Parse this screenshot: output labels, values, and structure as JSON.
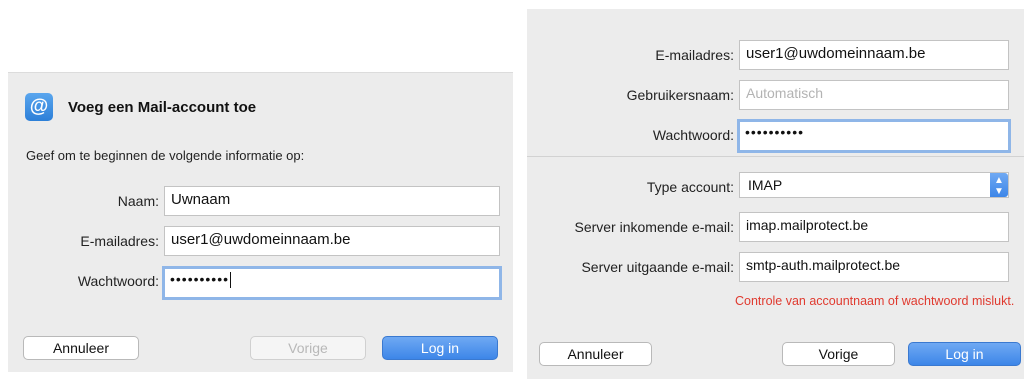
{
  "left_dialog": {
    "icon_glyph": "@",
    "title": "Voeg een Mail-account toe",
    "intro": "Geef om te beginnen de volgende informatie op:",
    "name_label": "Naam:",
    "name_value": "Uwnaam",
    "email_label": "E-mailadres:",
    "email_value": "user1@uwdomeinnaam.be",
    "password_label": "Wachtwoord:",
    "password_value": "••••••••••",
    "cancel_label": "Annuleer",
    "back_label": "Vorige",
    "login_label": "Log in"
  },
  "right_dialog": {
    "email_label": "E-mailadres:",
    "email_value": "user1@uwdomeinnaam.be",
    "username_label": "Gebruikersnaam:",
    "username_placeholder": "Automatisch",
    "password_label": "Wachtwoord:",
    "password_value": "••••••••••",
    "account_type_label": "Type account:",
    "account_type_value": "IMAP",
    "incoming_label": "Server inkomende e-mail:",
    "incoming_value": "imap.mailprotect.be",
    "outgoing_label": "Server uitgaande e-mail:",
    "outgoing_value": "smtp-auth.mailprotect.be",
    "error_message": "Controle van accountnaam of wachtwoord mislukt.",
    "cancel_label": "Annuleer",
    "back_label": "Vorige",
    "login_label": "Log in"
  },
  "colors": {
    "accent": "#3d86e8",
    "focus_ring": "#8fb6e8",
    "error": "#e03a2f"
  }
}
